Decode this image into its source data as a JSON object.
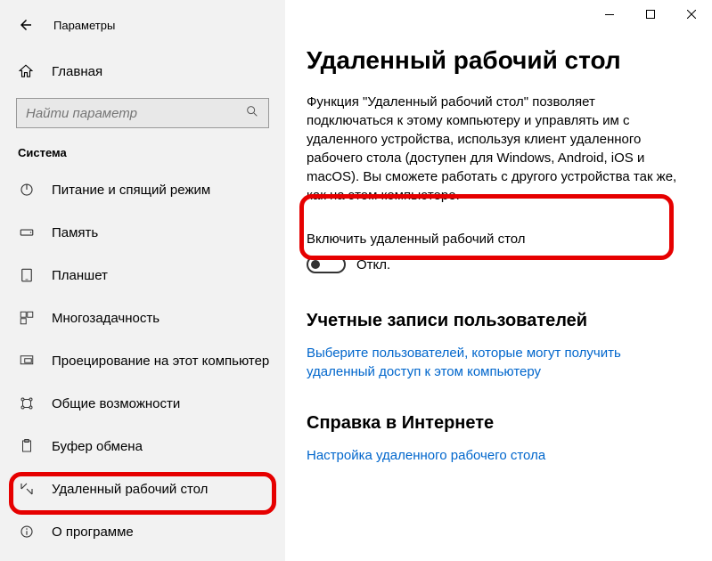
{
  "window": {
    "title": "Параметры"
  },
  "sidebar": {
    "home": "Главная",
    "search_placeholder": "Найти параметр",
    "category": "Система",
    "items": [
      {
        "label": "Питание и спящий режим"
      },
      {
        "label": "Память"
      },
      {
        "label": "Планшет"
      },
      {
        "label": "Многозадачность"
      },
      {
        "label": "Проецирование на этот компьютер"
      },
      {
        "label": "Общие возможности"
      },
      {
        "label": "Буфер обмена"
      },
      {
        "label": "Удаленный рабочий стол"
      },
      {
        "label": "О программе"
      }
    ]
  },
  "main": {
    "title": "Удаленный рабочий стол",
    "description": "Функция \"Удаленный рабочий стол\" позволяет подключаться к этому компьютеру и управлять им с удаленного устройства, используя клиент удаленного рабочего стола (доступен для Windows, Android, iOS и macOS). Вы сможете работать с другого устройства так же, как на этом компьютере.",
    "toggle": {
      "label": "Включить удаленный рабочий стол",
      "state": "Откл."
    },
    "accounts": {
      "heading": "Учетные записи пользователей",
      "link": "Выберите пользователей, которые могут получить удаленный доступ к этом компьютеру"
    },
    "help": {
      "heading": "Справка в Интернете",
      "link": "Настройка удаленного рабочего стола"
    }
  }
}
